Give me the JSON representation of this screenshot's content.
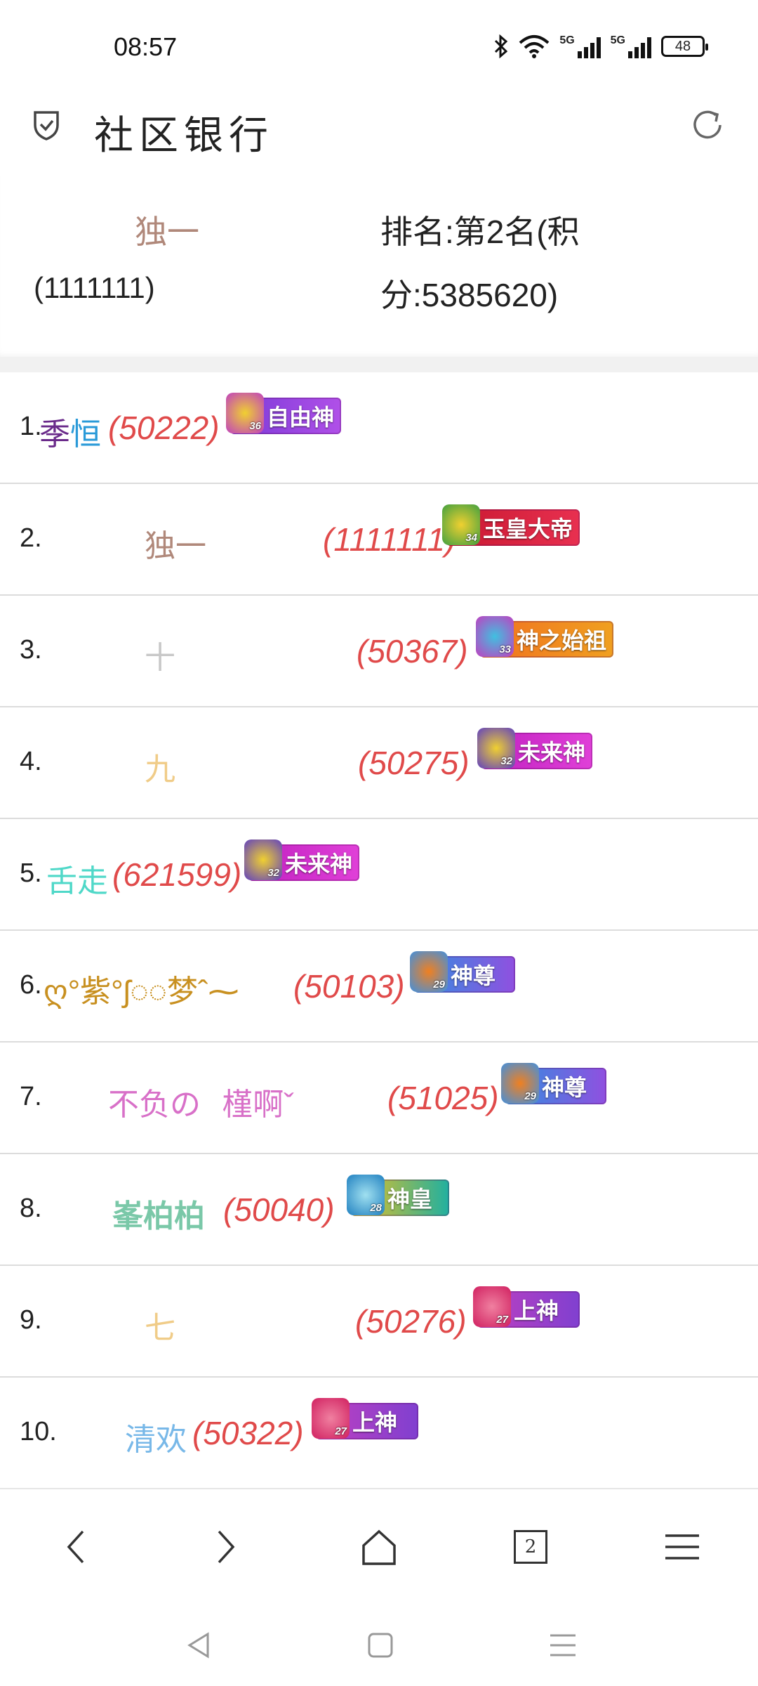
{
  "status_bar": {
    "time": "08:57",
    "net1": "5G",
    "net2": "5G",
    "battery": "48",
    "icons": [
      "bluetooth-icon",
      "wifi-icon",
      "signal-icon",
      "battery-icon"
    ]
  },
  "header": {
    "title": "社区银行",
    "left_icon": "shield-check-icon",
    "right_icon": "refresh-icon"
  },
  "user_card": {
    "name": "独一",
    "id": "(1111111)",
    "rank_line1": "排名:第2名(积",
    "rank_line2": "分:5385620)"
  },
  "rankings": [
    {
      "num": "1.",
      "name_parts": [
        "季",
        "恒"
      ],
      "score": "(50222)",
      "badge": {
        "level": "36",
        "title": "自由神"
      }
    },
    {
      "num": "2.",
      "name": "独一",
      "score": "(1111111)",
      "badge": {
        "level": "34",
        "title": "玉皇大帝"
      }
    },
    {
      "num": "3.",
      "name": "十",
      "score": "(50367)",
      "badge": {
        "level": "33",
        "title": "神之始祖"
      }
    },
    {
      "num": "4.",
      "name": "九",
      "score": "(50275)",
      "badge": {
        "level": "32",
        "title": "未来神"
      }
    },
    {
      "num": "5.",
      "name": "舌走",
      "score": "(621599)",
      "badge": {
        "level": "32",
        "title": "未来神"
      }
    },
    {
      "num": "6.",
      "name": "ღ°紫°ʃ◌◌梦ˆ⁓",
      "score": "(50103)",
      "badge": {
        "level": "29",
        "title": "神尊"
      }
    },
    {
      "num": "7.",
      "name": "不负の 槿啊ˇ",
      "score": "(51025)",
      "badge": {
        "level": "29",
        "title": "神尊"
      }
    },
    {
      "num": "8.",
      "name": "峯柏柏",
      "score": "(50040)",
      "badge": {
        "level": "28",
        "title": "神皇"
      }
    },
    {
      "num": "9.",
      "name": "七",
      "score": "(50276)",
      "badge": {
        "level": "27",
        "title": "上神"
      }
    },
    {
      "num": "10.",
      "name": "清欢",
      "score": "(50322)",
      "badge": {
        "level": "27",
        "title": "上神"
      }
    }
  ],
  "bottom_nav": {
    "tab_count": "2",
    "icons": [
      "back-icon",
      "forward-icon",
      "home-icon",
      "tabs-icon",
      "menu-icon"
    ]
  },
  "colors": {
    "score": "#e04a4a",
    "name_1a": "#6a2a8a",
    "name_1b": "#2a9ad8",
    "name_2": "#b0887a",
    "name_3": "#c8c8c8",
    "name_4": "#f0cc88",
    "name_5": "#4fd8c8",
    "name_6": "#c89020",
    "name_7": "#d870c8",
    "name_8": "#7ac8a8",
    "name_9": "#f0cc88",
    "name_10": "#78b8e8"
  }
}
